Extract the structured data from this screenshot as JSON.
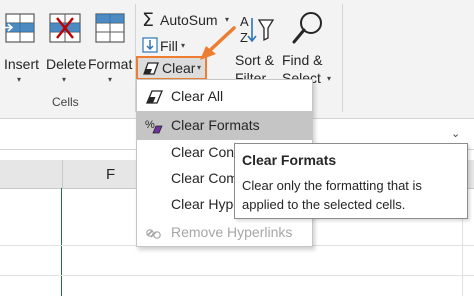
{
  "ribbon": {
    "insert_label": "Insert",
    "delete_label": "Delete",
    "format_label": "Format",
    "cells_group_label": "Cells",
    "autosum_label": "AutoSum",
    "fill_label": "Fill",
    "clear_label": "Clear",
    "sort_filter_label_1": "Sort &",
    "sort_filter_label_2": "Filter",
    "find_select_label_1": "Find &",
    "find_select_label_2": "Select",
    "icons": [
      "insert-cells-icon",
      "delete-cells-icon",
      "format-cells-icon",
      "sigma-icon",
      "fill-down-icon",
      "eraser-icon",
      "sort-az-icon",
      "magnifier-icon"
    ]
  },
  "clear_menu": {
    "items": [
      {
        "label": "Clear All",
        "icon": "eraser-icon",
        "state": "normal"
      },
      {
        "label": "Clear Formats",
        "icon": "percent-eraser-icon",
        "state": "highlighted"
      },
      {
        "label": "Clear Conte",
        "icon": "",
        "state": "normal"
      },
      {
        "label": "Clear Comr",
        "icon": "",
        "state": "normal"
      },
      {
        "label": "Clear Hype",
        "icon": "",
        "state": "normal"
      },
      {
        "label": "Remove Hyperlinks",
        "icon": "unlink-icon",
        "state": "disabled"
      }
    ]
  },
  "tooltip": {
    "title": "Clear Formats",
    "body": "Clear only the formatting that is applied to the selected cells."
  },
  "sheet": {
    "column_header": "F"
  },
  "colors": {
    "accent_orange": "#ed7d31",
    "excel_green": "#217346",
    "highlight": "#c5c5c5",
    "ribbon_bg": "#f3f3f3"
  }
}
